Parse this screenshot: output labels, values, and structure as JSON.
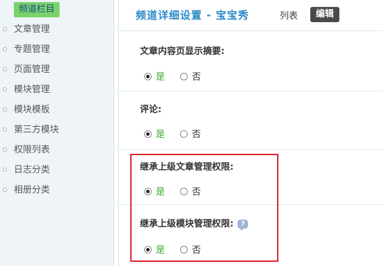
{
  "sidebar": {
    "items": [
      {
        "label": "频道栏目",
        "active": true
      },
      {
        "label": "文章管理"
      },
      {
        "label": "专题管理"
      },
      {
        "label": "页面管理"
      },
      {
        "label": "模块管理"
      },
      {
        "label": "模块模板"
      },
      {
        "label": "第三方模块"
      },
      {
        "label": "权限列表"
      },
      {
        "label": "日志分类"
      },
      {
        "label": "相册分类"
      }
    ]
  },
  "header": {
    "title": "频道详细设置 - 宝宝秀",
    "tab_list": "列表",
    "tab_edit": "编辑"
  },
  "options": {
    "yes": "是",
    "no": "否"
  },
  "settings": [
    {
      "label": "文章内容页显示摘要:",
      "value": "是"
    },
    {
      "label": "评论:",
      "value": "是"
    },
    {
      "label": "继承上级文章管理权限:",
      "value": "是"
    },
    {
      "label": "继承上级模块管理权限:",
      "value": "是"
    }
  ],
  "icons": {
    "help": "help-bubble-icon"
  },
  "colors": {
    "accent_title": "#2a8ac9",
    "active_nav": "#7ad36a",
    "highlight_box": "#d9262b",
    "yes_text": "#3aa82b"
  }
}
